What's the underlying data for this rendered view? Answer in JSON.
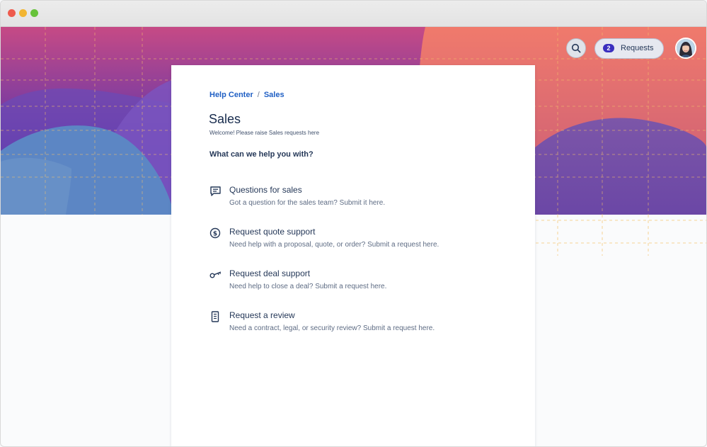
{
  "header": {
    "requests_count": "2",
    "requests_label": "Requests"
  },
  "breadcrumb": {
    "root": "Help Center",
    "separator": "/",
    "current": "Sales"
  },
  "page": {
    "title": "Sales",
    "description": "Welcome! Please raise Sales requests here",
    "prompt": "What can we help you with?"
  },
  "request_types": [
    {
      "title": "Questions for sales",
      "description": "Got a question for the sales team? Submit it here.",
      "icon": "chat-icon"
    },
    {
      "title": "Request quote support",
      "description": "Need help with a proposal, quote, or order? Submit a request here.",
      "icon": "dollar-icon"
    },
    {
      "title": "Request deal support",
      "description": "Need help to close a deal? Submit a request here.",
      "icon": "key-icon"
    },
    {
      "title": "Request a review",
      "description": "Need a contract, legal, or security review? Submit a request here.",
      "icon": "document-icon"
    }
  ],
  "colors": {
    "link": "#1f5fc4",
    "badge": "#3b2fbe",
    "text_primary": "#253858",
    "text_secondary": "#5e6c84"
  }
}
